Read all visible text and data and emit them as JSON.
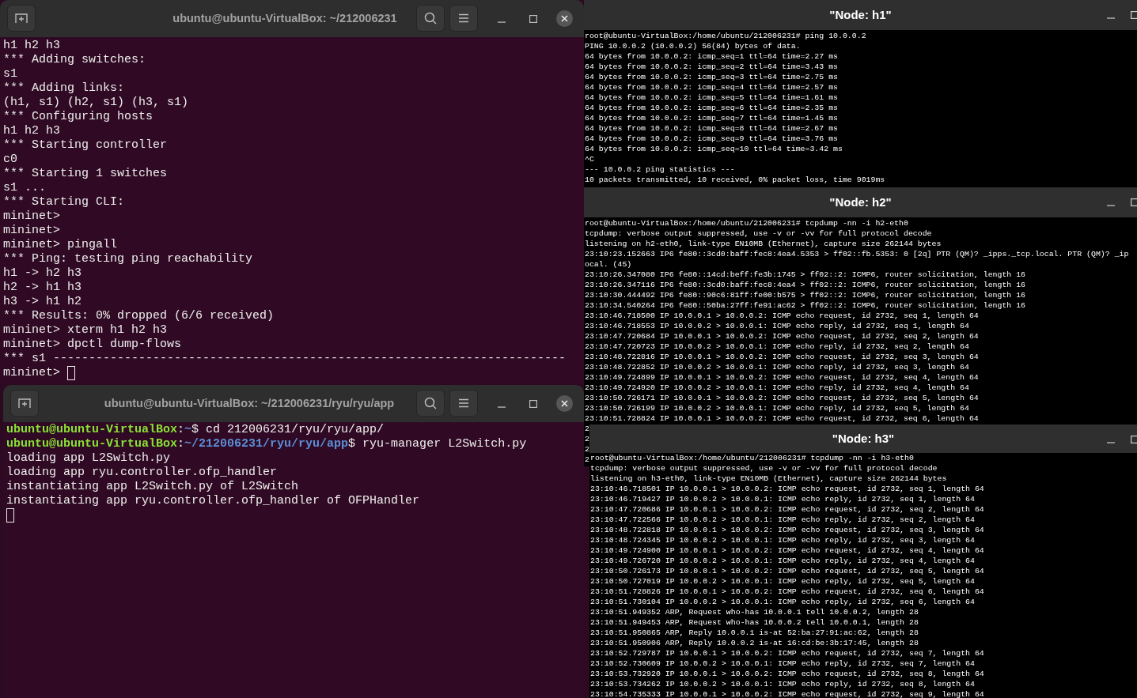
{
  "windows": [
    {
      "kind": "gnome",
      "title": "ubuntu@ubuntu-VirtualBox: ~/212006231",
      "lines": [
        "h1 h2 h3",
        "*** Adding switches:",
        "s1",
        "*** Adding links:",
        "(h1, s1) (h2, s1) (h3, s1)",
        "*** Configuring hosts",
        "h1 h2 h3",
        "*** Starting controller",
        "c0",
        "*** Starting 1 switches",
        "s1 ...",
        "*** Starting CLI:",
        "mininet>",
        "mininet>",
        "mininet> pingall",
        "*** Ping: testing ping reachability",
        "h1 -> h2 h3",
        "h2 -> h1 h3",
        "h3 -> h1 h2",
        "*** Results: 0% dropped (6/6 received)",
        "mininet> xterm h1 h2 h3",
        "mininet> dpctl dump-flows",
        "*** s1 ------------------------------------------------------------------------",
        {
          "text": "mininet>",
          "cursor": true
        }
      ]
    },
    {
      "kind": "gnome",
      "title": "ubuntu@ubuntu-VirtualBox: ~/212006231/ryu/ryu/app",
      "lines": [
        {
          "segments": [
            {
              "kind": "user",
              "text": "ubuntu@ubuntu-VirtualBox"
            },
            {
              "kind": "plain",
              "text": ":"
            },
            {
              "kind": "path",
              "text": "~"
            },
            {
              "kind": "plain",
              "text": "$ cd 212006231/ryu/ryu/app/"
            }
          ]
        },
        {
          "segments": [
            {
              "kind": "user",
              "text": "ubuntu@ubuntu-VirtualBox"
            },
            {
              "kind": "plain",
              "text": ":"
            },
            {
              "kind": "path",
              "text": "~/212006231/ryu/ryu/app"
            },
            {
              "kind": "plain",
              "text": "$ ryu-manager L2Switch.py"
            }
          ]
        },
        "loading app L2Switch.py",
        "loading app ryu.controller.ofp_handler",
        "instantiating app L2Switch.py of L2Switch",
        "instantiating app ryu.controller.ofp_handler of OFPHandler",
        {
          "cursor": true
        }
      ]
    },
    {
      "kind": "xterm",
      "title": "\"Node: h1\"",
      "lines": [
        "root@ubuntu-VirtualBox:/home/ubuntu/212006231# ping 10.0.0.2",
        "PING 10.0.0.2 (10.0.0.2) 56(84) bytes of data.",
        "64 bytes from 10.0.0.2: icmp_seq=1 ttl=64 time=2.27 ms",
        "64 bytes from 10.0.0.2: icmp_seq=2 ttl=64 time=3.43 ms",
        "64 bytes from 10.0.0.2: icmp_seq=3 ttl=64 time=2.75 ms",
        "64 bytes from 10.0.0.2: icmp_seq=4 ttl=64 time=2.57 ms",
        "64 bytes from 10.0.0.2: icmp_seq=5 ttl=64 time=1.61 ms",
        "64 bytes from 10.0.0.2: icmp_seq=6 ttl=64 time=2.35 ms",
        "64 bytes from 10.0.0.2: icmp_seq=7 ttl=64 time=1.45 ms",
        "64 bytes from 10.0.0.2: icmp_seq=8 ttl=64 time=2.67 ms",
        "64 bytes from 10.0.0.2: icmp_seq=9 ttl=64 time=3.76 ms",
        "64 bytes from 10.0.0.2: icmp_seq=10 ttl=64 time=3.42 ms",
        "^C",
        "--- 10.0.0.2 ping statistics ---",
        "10 packets transmitted, 10 received, 0% packet loss, time 9019ms"
      ]
    },
    {
      "kind": "xterm",
      "title": "\"Node: h2\"",
      "lines": [
        "root@ubuntu-VirtualBox:/home/ubuntu/212006231# tcpdump -nn -i h2-eth0",
        "tcpdump: verbose output suppressed, use -v or -vv for full protocol decode",
        "listening on h2-eth0, link-type EN10MB (Ethernet), capture size 262144 bytes",
        "23:10:23.152663 IP6 fe80::3cd0:baff:fec8:4ea4.5353 > ff02::fb.5353: 0 [2q] PTR (QM)? _ipps._tcp.local. PTR (QM)? _ip",
        "ocal. (45)",
        "23:10:26.347080 IP6 fe80::14cd:beff:fe3b:1745 > ff02::2: ICMP6, router solicitation, length 16",
        "23:10:26.347116 IP6 fe80::3cd0:baff:fec8:4ea4 > ff02::2: ICMP6, router solicitation, length 16",
        "23:10:30.444492 IP6 fe80::90c6:81ff:fe00:b575 > ff02::2: ICMP6, router solicitation, length 16",
        "23:10:34.540264 IP6 fe80::50ba:27ff:fe91:ac62 > ff02::2: ICMP6, router solicitation, length 16",
        "23:10:46.718500 IP 10.0.0.1 > 10.0.0.2: ICMP echo request, id 2732, seq 1, length 64",
        "23:10:46.718553 IP 10.0.0.2 > 10.0.0.1: ICMP echo reply, id 2732, seq 1, length 64",
        "23:10:47.720684 IP 10.0.0.1 > 10.0.0.2: ICMP echo request, id 2732, seq 2, length 64",
        "23:10:47.720723 IP 10.0.0.2 > 10.0.0.1: ICMP echo reply, id 2732, seq 2, length 64",
        "23:10:48.722816 IP 10.0.0.1 > 10.0.0.2: ICMP echo request, id 2732, seq 3, length 64",
        "23:10:48.722852 IP 10.0.0.2 > 10.0.0.1: ICMP echo reply, id 2732, seq 3, length 64",
        "23:10:49.724899 IP 10.0.0.1 > 10.0.0.2: ICMP echo request, id 2732, seq 4, length 64",
        "23:10:49.724920 IP 10.0.0.2 > 10.0.0.1: ICMP echo reply, id 2732, seq 4, length 64",
        "23:10:50.726171 IP 10.0.0.1 > 10.0.0.2: ICMP echo request, id 2732, seq 5, length 64",
        "23:10:50.726199 IP 10.0.0.2 > 10.0.0.1: ICMP echo reply, id 2732, seq 5, length 64",
        "23:10:51.728824 IP 10.0.0.1 > 10.0.0.2: ICMP echo request, id 2732, seq 6, length 64",
        "2",
        "2",
        "2",
        "2"
      ]
    },
    {
      "kind": "xterm",
      "title": "\"Node: h3\"",
      "lines": [
        "root@ubuntu-VirtualBox:/home/ubuntu/212006231# tcpdump -nn -i h3-eth0",
        "tcpdump: verbose output suppressed, use -v or -vv for full protocol decode",
        "listening on h3-eth0, link-type EN10MB (Ethernet), capture size 262144 bytes",
        "23:10:46.718501 IP 10.0.0.1 > 10.0.0.2: ICMP echo request, id 2732, seq 1, length 64",
        "23:10:46.719427 IP 10.0.0.2 > 10.0.0.1: ICMP echo reply, id 2732, seq 1, length 64",
        "23:10:47.720686 IP 10.0.0.1 > 10.0.0.2: ICMP echo request, id 2732, seq 2, length 64",
        "23:10:47.722566 IP 10.0.0.2 > 10.0.0.1: ICMP echo reply, id 2732, seq 2, length 64",
        "23:10:48.722818 IP 10.0.0.1 > 10.0.0.2: ICMP echo request, id 2732, seq 3, length 64",
        "23:10:48.724345 IP 10.0.0.2 > 10.0.0.1: ICMP echo reply, id 2732, seq 3, length 64",
        "23:10:49.724900 IP 10.0.0.1 > 10.0.0.2: ICMP echo request, id 2732, seq 4, length 64",
        "23:10:49.726720 IP 10.0.0.2 > 10.0.0.1: ICMP echo reply, id 2732, seq 4, length 64",
        "23:10:50.726173 IP 10.0.0.1 > 10.0.0.2: ICMP echo request, id 2732, seq 5, length 64",
        "23:10:50.727019 IP 10.0.0.2 > 10.0.0.1: ICMP echo reply, id 2732, seq 5, length 64",
        "23:10:51.728826 IP 10.0.0.1 > 10.0.0.2: ICMP echo request, id 2732, seq 6, length 64",
        "23:10:51.730104 IP 10.0.0.2 > 10.0.0.1: ICMP echo reply, id 2732, seq 6, length 64",
        "23:10:51.949352 ARP, Request who-has 10.0.0.1 tell 10.0.0.2, length 28",
        "23:10:51.949453 ARP, Request who-has 10.0.0.2 tell 10.0.0.1, length 28",
        "23:10:51.950865 ARP, Reply 10.0.0.1 is-at 52:ba:27:91:ac:62, length 28",
        "23:10:51.950906 ARP, Reply 10.0.0.2 is-at 16:cd:be:3b:17:45, length 28",
        "23:10:52.729787 IP 10.0.0.1 > 10.0.0.2: ICMP echo request, id 2732, seq 7, length 64",
        "23:10:52.730609 IP 10.0.0.2 > 10.0.0.1: ICMP echo reply, id 2732, seq 7, length 64",
        "23:10:53.732920 IP 10.0.0.1 > 10.0.0.2: ICMP echo request, id 2732, seq 8, length 64",
        "23:10:53.734262 IP 10.0.0.2 > 10.0.0.1: ICMP echo reply, id 2732, seq 8, length 64",
        "23:10:54.735333 IP 10.0.0.1 > 10.0.0.2: ICMP echo request, id 2732, seq 9, length 64"
      ]
    }
  ]
}
